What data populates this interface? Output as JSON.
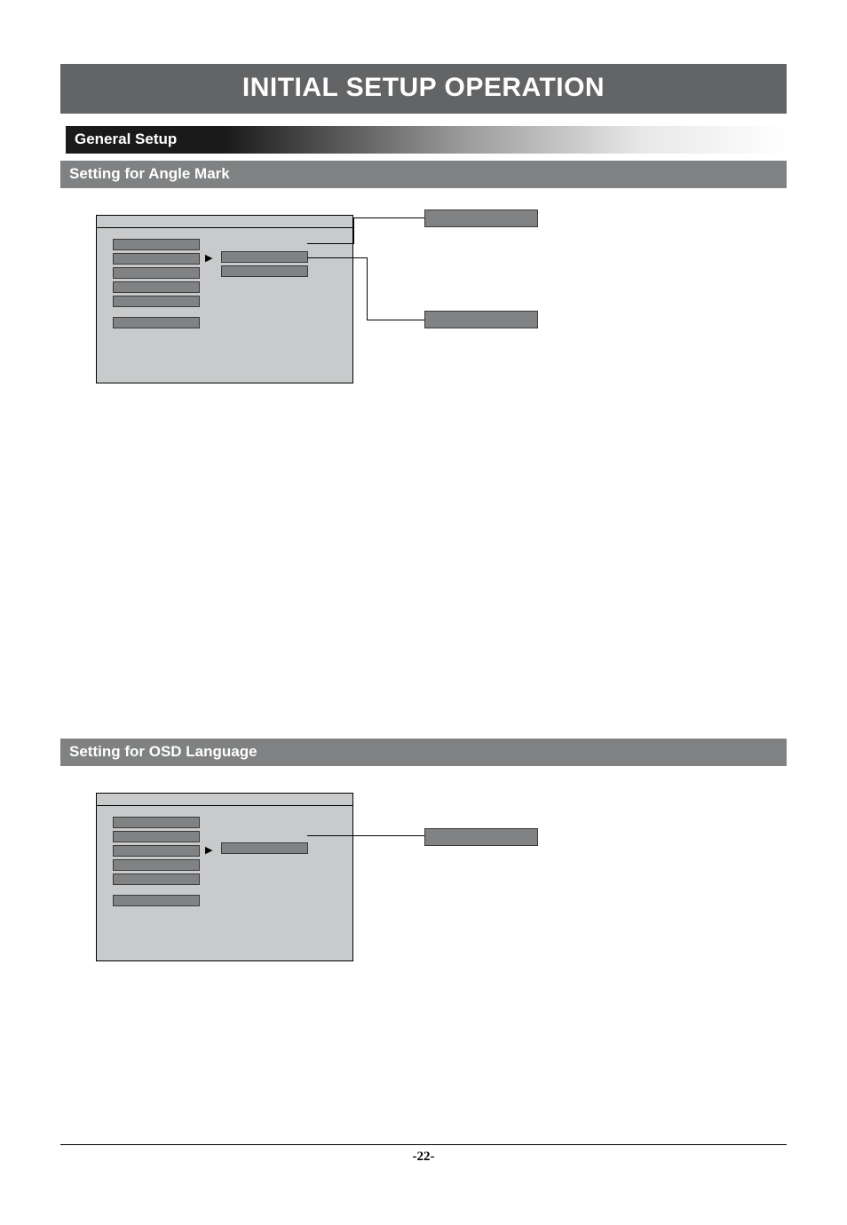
{
  "title": "INITIAL SETUP OPERATION",
  "section1": {
    "heading": "General Setup",
    "subheading": "Setting for Angle Mark"
  },
  "section2": {
    "subheading": "Setting for OSD Language"
  },
  "page_number": "-22-"
}
